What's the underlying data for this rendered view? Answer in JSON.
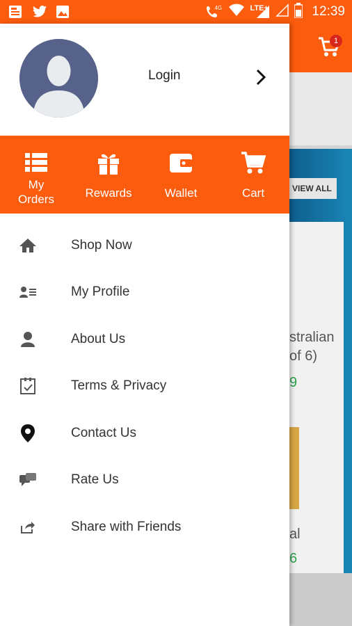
{
  "status_bar": {
    "time": "12:39",
    "network_label": "4G",
    "lte_label": "LTE+",
    "colors": {
      "background": "#fb5c0e"
    },
    "left_icons": [
      "news-icon",
      "twitter-icon",
      "image-icon"
    ],
    "right_icons": [
      "wifi-call-icon",
      "wifi-icon",
      "signal-icon",
      "signal-empty-icon",
      "battery-icon"
    ]
  },
  "drawer": {
    "profile": {
      "login_label": "Login"
    },
    "quick_actions": [
      {
        "label": "My\nOrders",
        "icon": "list-icon"
      },
      {
        "label": "Rewards",
        "icon": "gift-icon"
      },
      {
        "label": "Wallet",
        "icon": "wallet-icon"
      },
      {
        "label": "Cart",
        "icon": "cart-icon"
      }
    ],
    "menu": [
      {
        "label": "Shop Now",
        "icon": "home-icon"
      },
      {
        "label": "My Profile",
        "icon": "profile-card-icon"
      },
      {
        "label": "About Us",
        "icon": "person-icon"
      },
      {
        "label": "Terms & Privacy",
        "icon": "checklist-icon"
      },
      {
        "label": "Contact Us",
        "icon": "location-pin-icon"
      },
      {
        "label": "Rate Us",
        "icon": "chat-bubbles-icon"
      },
      {
        "label": "Share with Friends",
        "icon": "share-icon"
      }
    ]
  },
  "background_page": {
    "cart_badge": "1",
    "view_all": "VIEW ALL",
    "product_text_line1": "stralian",
    "product_text_line2": "of 6)",
    "product_price_1": "9",
    "product_text_3": "al",
    "product_price_2": "6"
  },
  "colors": {
    "brand": "#fb5c0e",
    "text": "#333333",
    "avatar": "#57628a"
  }
}
